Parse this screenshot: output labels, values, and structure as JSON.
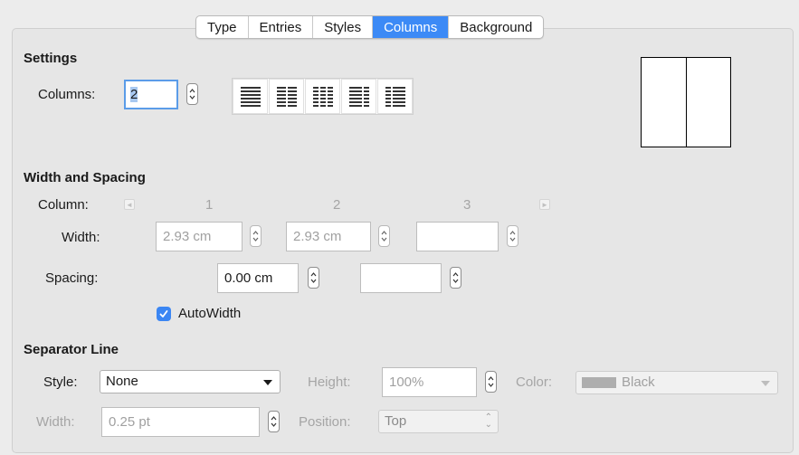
{
  "tabs": [
    {
      "label": "Type"
    },
    {
      "label": "Entries"
    },
    {
      "label": "Styles"
    },
    {
      "label": "Columns"
    },
    {
      "label": "Background"
    }
  ],
  "active_tab": "Columns",
  "settings": {
    "heading": "Settings",
    "columns_label": "Columns:",
    "columns_value": "2",
    "layout_icons": [
      "one-column-layout-icon",
      "two-column-layout-icon",
      "three-column-layout-icon",
      "left-wide-layout-icon",
      "right-wide-layout-icon"
    ]
  },
  "width_spacing": {
    "heading": "Width and Spacing",
    "column_label": "Column:",
    "column_numbers": [
      "1",
      "2",
      "3"
    ],
    "width_label": "Width:",
    "widths": [
      "2.93 cm",
      "2.93 cm",
      ""
    ],
    "spacing_label": "Spacing:",
    "spacings": [
      "0.00 cm",
      ""
    ],
    "autowidth_label": "AutoWidth",
    "autowidth_checked": true
  },
  "separator": {
    "heading": "Separator Line",
    "style_label": "Style:",
    "style_value": "None",
    "height_label": "Height:",
    "height_value": "100%",
    "color_label": "Color:",
    "color_value": "Black",
    "color_swatch": "#aeaeae",
    "width_label": "Width:",
    "width_value": "0.25 pt",
    "position_label": "Position:",
    "position_value": "Top"
  },
  "colors": {
    "accent": "#3c8af6",
    "focus_border": "#5b9ce8"
  }
}
